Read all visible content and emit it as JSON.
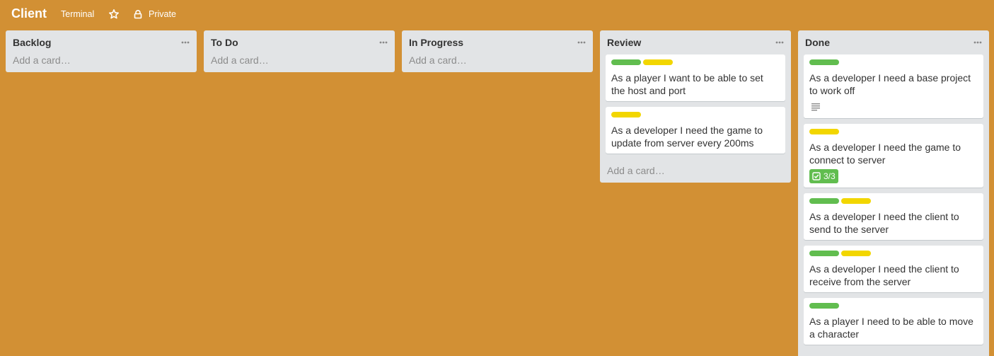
{
  "board": {
    "title": "Client",
    "team": "Terminal",
    "privacy": "Private",
    "background": "#d29034"
  },
  "icons": {
    "star": "star-icon",
    "privacy": "lock-icon",
    "list_menu": "ellipsis-icon",
    "description": "description-icon",
    "checklist": "checklist-icon"
  },
  "colors": {
    "label_green": "#61bd4f",
    "label_yellow": "#f2d600",
    "list_bg": "#e2e4e6"
  },
  "lists": [
    {
      "title": "Backlog",
      "add_card": "Add a card…",
      "cards": []
    },
    {
      "title": "To Do",
      "add_card": "Add a card…",
      "cards": []
    },
    {
      "title": "In Progress",
      "add_card": "Add a card…",
      "cards": []
    },
    {
      "title": "Review",
      "add_card": "Add a card…",
      "cards": [
        {
          "labels": [
            "green",
            "yellow"
          ],
          "title": "As a player I want to be able to set the host and port"
        },
        {
          "labels": [
            "yellow"
          ],
          "title": "As a developer I need the game to update from server every 200ms"
        }
      ]
    },
    {
      "title": "Done",
      "cards": [
        {
          "labels": [
            "green"
          ],
          "title": "As a developer I need a base project to work off",
          "has_description": true
        },
        {
          "labels": [
            "yellow"
          ],
          "title": "As a developer I need the game to connect to server",
          "checklist": "3/3"
        },
        {
          "labels": [
            "green",
            "yellow"
          ],
          "title": "As a developer I need the client to send to the server"
        },
        {
          "labels": [
            "green",
            "yellow"
          ],
          "title": "As a developer I need the client to receive from the server"
        },
        {
          "labels": [
            "green"
          ],
          "title": "As a player I need to be able to move a character"
        }
      ]
    }
  ]
}
